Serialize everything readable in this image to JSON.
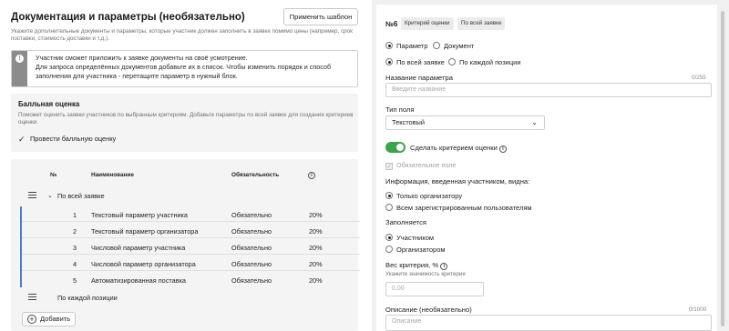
{
  "left": {
    "title": "Документация и параметры (необязательно)",
    "apply_template_button": "Применить шаблон",
    "subtitle": "Укажите дополнительные документы и параметры, которые участник должен заполнить в заявке помимо цены (например, срок поставки, стоимость доставки и т.д.).",
    "info": {
      "line1": "Участник сможет приложить к заявке документы на своё усмотрение.",
      "line2": "Для запроса определённых документов добавьте их в список. Чтобы изменить порядок и способ заполнения для участника - перетащите параметр в нужный блок."
    },
    "rating": {
      "title": "Балльная оценка",
      "description": "Поможет оценить заявки участников по выбранным критериям. Добавьте параметры по всей заявке для создания критериев оценки.",
      "checkbox_label": "Провести балльную оценку"
    },
    "table": {
      "headers": {
        "num": "№",
        "name": "Наименование",
        "required": "Обязательность",
        "weight_icon": "i"
      },
      "group_all": "По всей заявке",
      "rows": [
        {
          "num": "1",
          "name": "Текстовый параметр участника",
          "required": "Обязательно",
          "weight": "20%"
        },
        {
          "num": "2",
          "name": "Текстовый параметр организатора",
          "required": "Обязательно",
          "weight": "20%"
        },
        {
          "num": "3",
          "name": "Числовой параметр участника",
          "required": "Обязательно",
          "weight": "20%"
        },
        {
          "num": "4",
          "name": "Числовой параметр организатора",
          "required": "Обязательно",
          "weight": "20%"
        },
        {
          "num": "5",
          "name": "Автоматизированная поставка",
          "required": "Обязательно",
          "weight": "20%"
        }
      ],
      "group_each": "По каждой позиции",
      "add_button": "Добавить"
    }
  },
  "right": {
    "num": "№6",
    "tags": [
      "Критерий оценки",
      "По всей заявке"
    ],
    "type_radio": {
      "option1": "Параметр",
      "option2": "Документ",
      "selected": "Параметр"
    },
    "scope_radio": {
      "option1": "По всей заявке",
      "option2": "По каждой позиции",
      "selected": "По всей заявке"
    },
    "name_field": {
      "label": "Название параметра",
      "counter": "0/255",
      "placeholder": "Введите название"
    },
    "field_type": {
      "label": "Тип поля",
      "value": "Текстовый"
    },
    "criterion_toggle": {
      "label": "Сделать критерием оценки",
      "on": true
    },
    "required_check": "Обязательное поле",
    "visibility": {
      "label": "Информация, введенная участником, видна:",
      "option1": "Только организатору",
      "option2": "Всем зарегистрированным пользователям",
      "selected": "Только организатору"
    },
    "filled_by": {
      "label": "Заполняется",
      "option1": "Участником",
      "option2": "Организатором",
      "selected": "Участником"
    },
    "weight": {
      "label": "Вес критерия, %",
      "hint": "Укажите значимость критерия",
      "placeholder": "0,00"
    },
    "description": {
      "label": "Описание (необязательно)",
      "counter": "0/1000",
      "placeholder": "Описание"
    }
  },
  "colors": {
    "accent_blue": "#4a7fd4",
    "toggle_green": "#3aa64a"
  }
}
